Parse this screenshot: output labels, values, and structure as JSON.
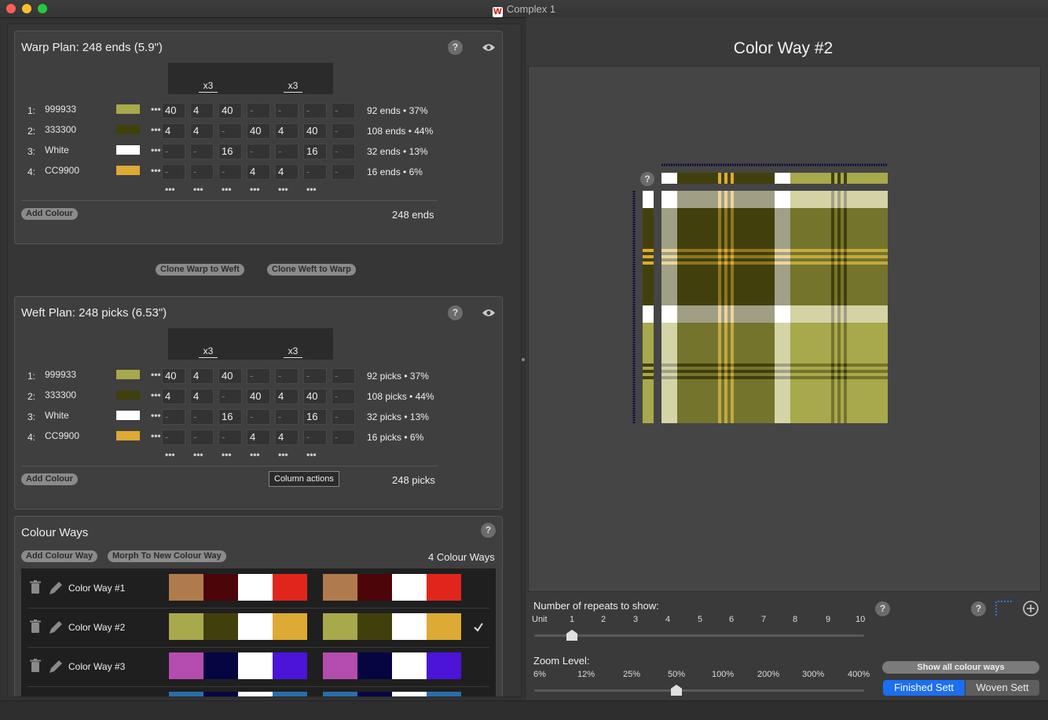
{
  "window": {
    "title": "Complex 1",
    "app_icon": "W"
  },
  "colors": {
    "c999933": "#A8A84C",
    "c333300": "#41400D",
    "white": "#FFFFFF",
    "cCC9900": "#DDAA33"
  },
  "warp": {
    "title": "Warp Plan:  248 ends (5.9\")",
    "repeats": [
      "x3",
      "x3"
    ],
    "rows": [
      {
        "num": "1:",
        "name": "999933",
        "color": "#A8A84C",
        "cells": [
          "40",
          "4",
          "40",
          "-",
          "-",
          "-",
          "-"
        ],
        "stat": "92 ends • 37%"
      },
      {
        "num": "2:",
        "name": "333300",
        "color": "#41400D",
        "cells": [
          "4",
          "4",
          "-",
          "40",
          "4",
          "40",
          "-"
        ],
        "stat": "108 ends • 44%"
      },
      {
        "num": "3:",
        "name": "White",
        "color": "#FFFFFF",
        "cells": [
          "-",
          "-",
          "16",
          "-",
          "-",
          "16",
          "-"
        ],
        "stat": "32 ends • 13%"
      },
      {
        "num": "4:",
        "name": "CC9900",
        "color": "#DDAA33",
        "cells": [
          "-",
          "-",
          "-",
          "4",
          "4",
          "-",
          "-"
        ],
        "stat": "16 ends • 6%"
      }
    ],
    "add_label": "Add Colour",
    "total": "248 ends"
  },
  "clone": {
    "warp_to_weft": "Clone Warp to Weft",
    "weft_to_warp": "Clone Weft to Warp"
  },
  "weft": {
    "title": "Weft Plan:  248 picks (6.53\")",
    "repeats": [
      "x3",
      "x3"
    ],
    "rows": [
      {
        "num": "1:",
        "name": "999933",
        "color": "#A8A84C",
        "cells": [
          "40",
          "4",
          "40",
          "-",
          "-",
          "-",
          "-"
        ],
        "stat": "92 picks • 37%"
      },
      {
        "num": "2:",
        "name": "333300",
        "color": "#41400D",
        "cells": [
          "4",
          "4",
          "-",
          "40",
          "4",
          "40",
          "-"
        ],
        "stat": "108 picks • 44%"
      },
      {
        "num": "3:",
        "name": "White",
        "color": "#FFFFFF",
        "cells": [
          "-",
          "-",
          "16",
          "-",
          "-",
          "16",
          "-"
        ],
        "stat": "32 picks • 13%"
      },
      {
        "num": "4:",
        "name": "CC9900",
        "color": "#DDAA33",
        "cells": [
          "-",
          "-",
          "-",
          "4",
          "4",
          "-",
          "-"
        ],
        "stat": "16 picks • 6%"
      }
    ],
    "add_label": "Add Colour",
    "total": "248 picks",
    "tooltip": "Column actions"
  },
  "colourways": {
    "title": "Colour Ways",
    "add_label": "Add Colour Way",
    "morph_label": "Morph To New Colour Way",
    "count": "4 Colour Ways",
    "items": [
      {
        "name": "Color Way #1",
        "swatches": [
          "#B07B4C",
          "#4C0508",
          "#FFFFFF",
          "#E0261C"
        ],
        "selected": false
      },
      {
        "name": "Color Way #2",
        "swatches": [
          "#A8A84C",
          "#41400D",
          "#FFFFFF",
          "#DDAA33"
        ],
        "selected": true
      },
      {
        "name": "Color Way #3",
        "swatches": [
          "#B54CB0",
          "#050541",
          "#FFFFFF",
          "#4B14D8"
        ],
        "selected": false
      },
      {
        "name": "",
        "swatches": [
          "#2A6EAA",
          "#050541",
          "#FFFFFF",
          "#2A6EAA"
        ],
        "selected": false
      }
    ]
  },
  "preview": {
    "title": "Color Way #2"
  },
  "repeats_slider": {
    "label": "Number of repeats to show:",
    "ticks": [
      "Unit",
      "1",
      "2",
      "3",
      "4",
      "5",
      "6",
      "7",
      "8",
      "9",
      "10"
    ],
    "value": "1"
  },
  "zoom_slider": {
    "label": "Zoom Level:",
    "ticks": [
      "6%",
      "12%",
      "25%",
      "50%",
      "100%",
      "200%",
      "300%",
      "400%"
    ],
    "value": "50%"
  },
  "buttons": {
    "show_all": "Show all colour ways",
    "finished": "Finished Sett",
    "woven": "Woven Sett"
  },
  "help_glyph": "?"
}
